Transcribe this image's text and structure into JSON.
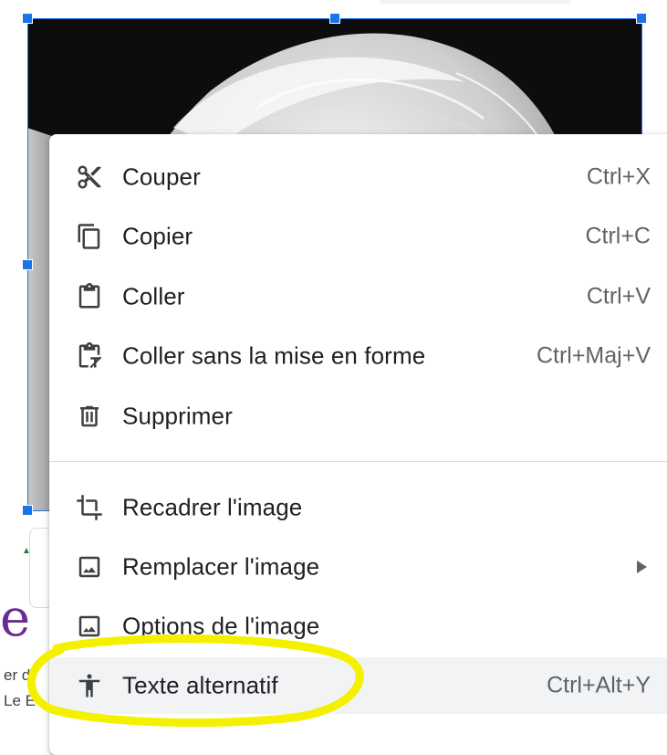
{
  "colors": {
    "selection": "#1a73e8",
    "menu_background": "#ffffff",
    "hover_background": "#f1f3f4",
    "highlight_marker": "#f4f000"
  },
  "background_document": {
    "partial_text_lines": [
      "er d",
      "Le E"
    ],
    "partial_glyph": "e"
  },
  "context_menu": {
    "section_edit": [
      {
        "label": "Couper",
        "shortcut": "Ctrl+X",
        "icon": "scissors-icon"
      },
      {
        "label": "Copier",
        "shortcut": "Ctrl+C",
        "icon": "copy-icon"
      },
      {
        "label": "Coller",
        "shortcut": "Ctrl+V",
        "icon": "clipboard-icon"
      },
      {
        "label": "Coller sans la mise en forme",
        "shortcut": "Ctrl+Maj+V",
        "icon": "clipboard-clear-format-icon"
      },
      {
        "label": "Supprimer",
        "shortcut": "",
        "icon": "trash-icon"
      }
    ],
    "section_image": [
      {
        "label": "Recadrer l'image",
        "shortcut": "",
        "icon": "crop-icon"
      },
      {
        "label": "Remplacer l'image",
        "shortcut": "",
        "icon": "image-icon",
        "has_submenu": true
      },
      {
        "label": "Options de l'image",
        "shortcut": "",
        "icon": "image-icon"
      },
      {
        "label": "Texte alternatif",
        "shortcut": "Ctrl+Alt+Y",
        "icon": "accessibility-icon",
        "hovered": true
      }
    ]
  }
}
